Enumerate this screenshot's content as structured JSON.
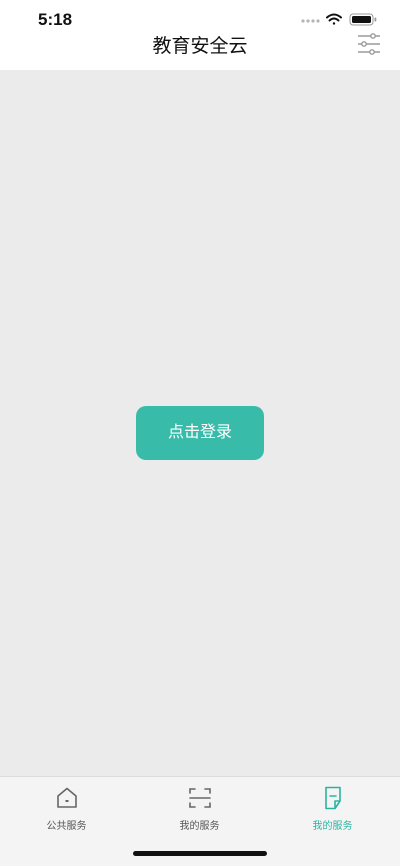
{
  "status_bar": {
    "time": "5:18"
  },
  "header": {
    "title": "教育安全云"
  },
  "main": {
    "login_label": "点击登录"
  },
  "tab_bar": {
    "tabs": [
      {
        "label": "公共服务",
        "icon": "home-icon",
        "active": false
      },
      {
        "label": "我的服务",
        "icon": "scan-icon",
        "active": false
      },
      {
        "label": "我的服务",
        "icon": "document-edit-icon",
        "active": true
      }
    ]
  },
  "colors": {
    "accent": "#38bba9",
    "active_tab": "#2bb3a1",
    "background": "#ebebeb"
  }
}
